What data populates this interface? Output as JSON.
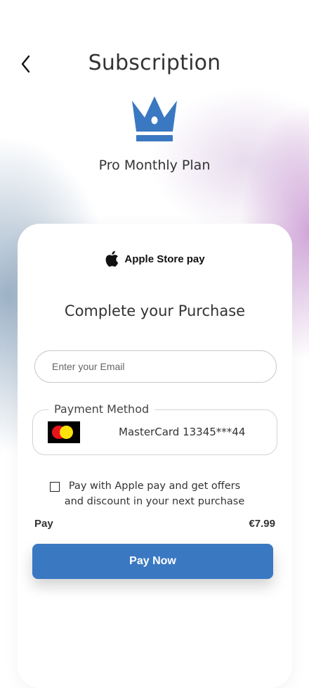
{
  "header": {
    "title": "Subscription",
    "plan_name": "Pro Monthly Plan",
    "crown_icon": "crown-icon",
    "back_icon": "chevron-left-icon"
  },
  "payment_provider": {
    "label": "Apple Store pay",
    "icon": "apple-logo-icon"
  },
  "checkout": {
    "heading": "Complete your Purchase",
    "email": {
      "value": "",
      "placeholder": "Enter your Email"
    },
    "payment_method": {
      "legend": "Payment Method",
      "card_label": "MasterCard 13345***44",
      "card_icon": "mastercard-logo-icon"
    },
    "apple_pay_offer": {
      "checked": false,
      "text": "Pay with Apple pay and get offers and discount in your next purchase"
    },
    "summary": {
      "label": "Pay",
      "amount": "€7.99"
    },
    "pay_button": "Pay Now"
  },
  "colors": {
    "primary": "#3a78c2",
    "text": "#333333",
    "mastercard_red": "#e8131b",
    "mastercard_yellow": "#fbe10a"
  }
}
